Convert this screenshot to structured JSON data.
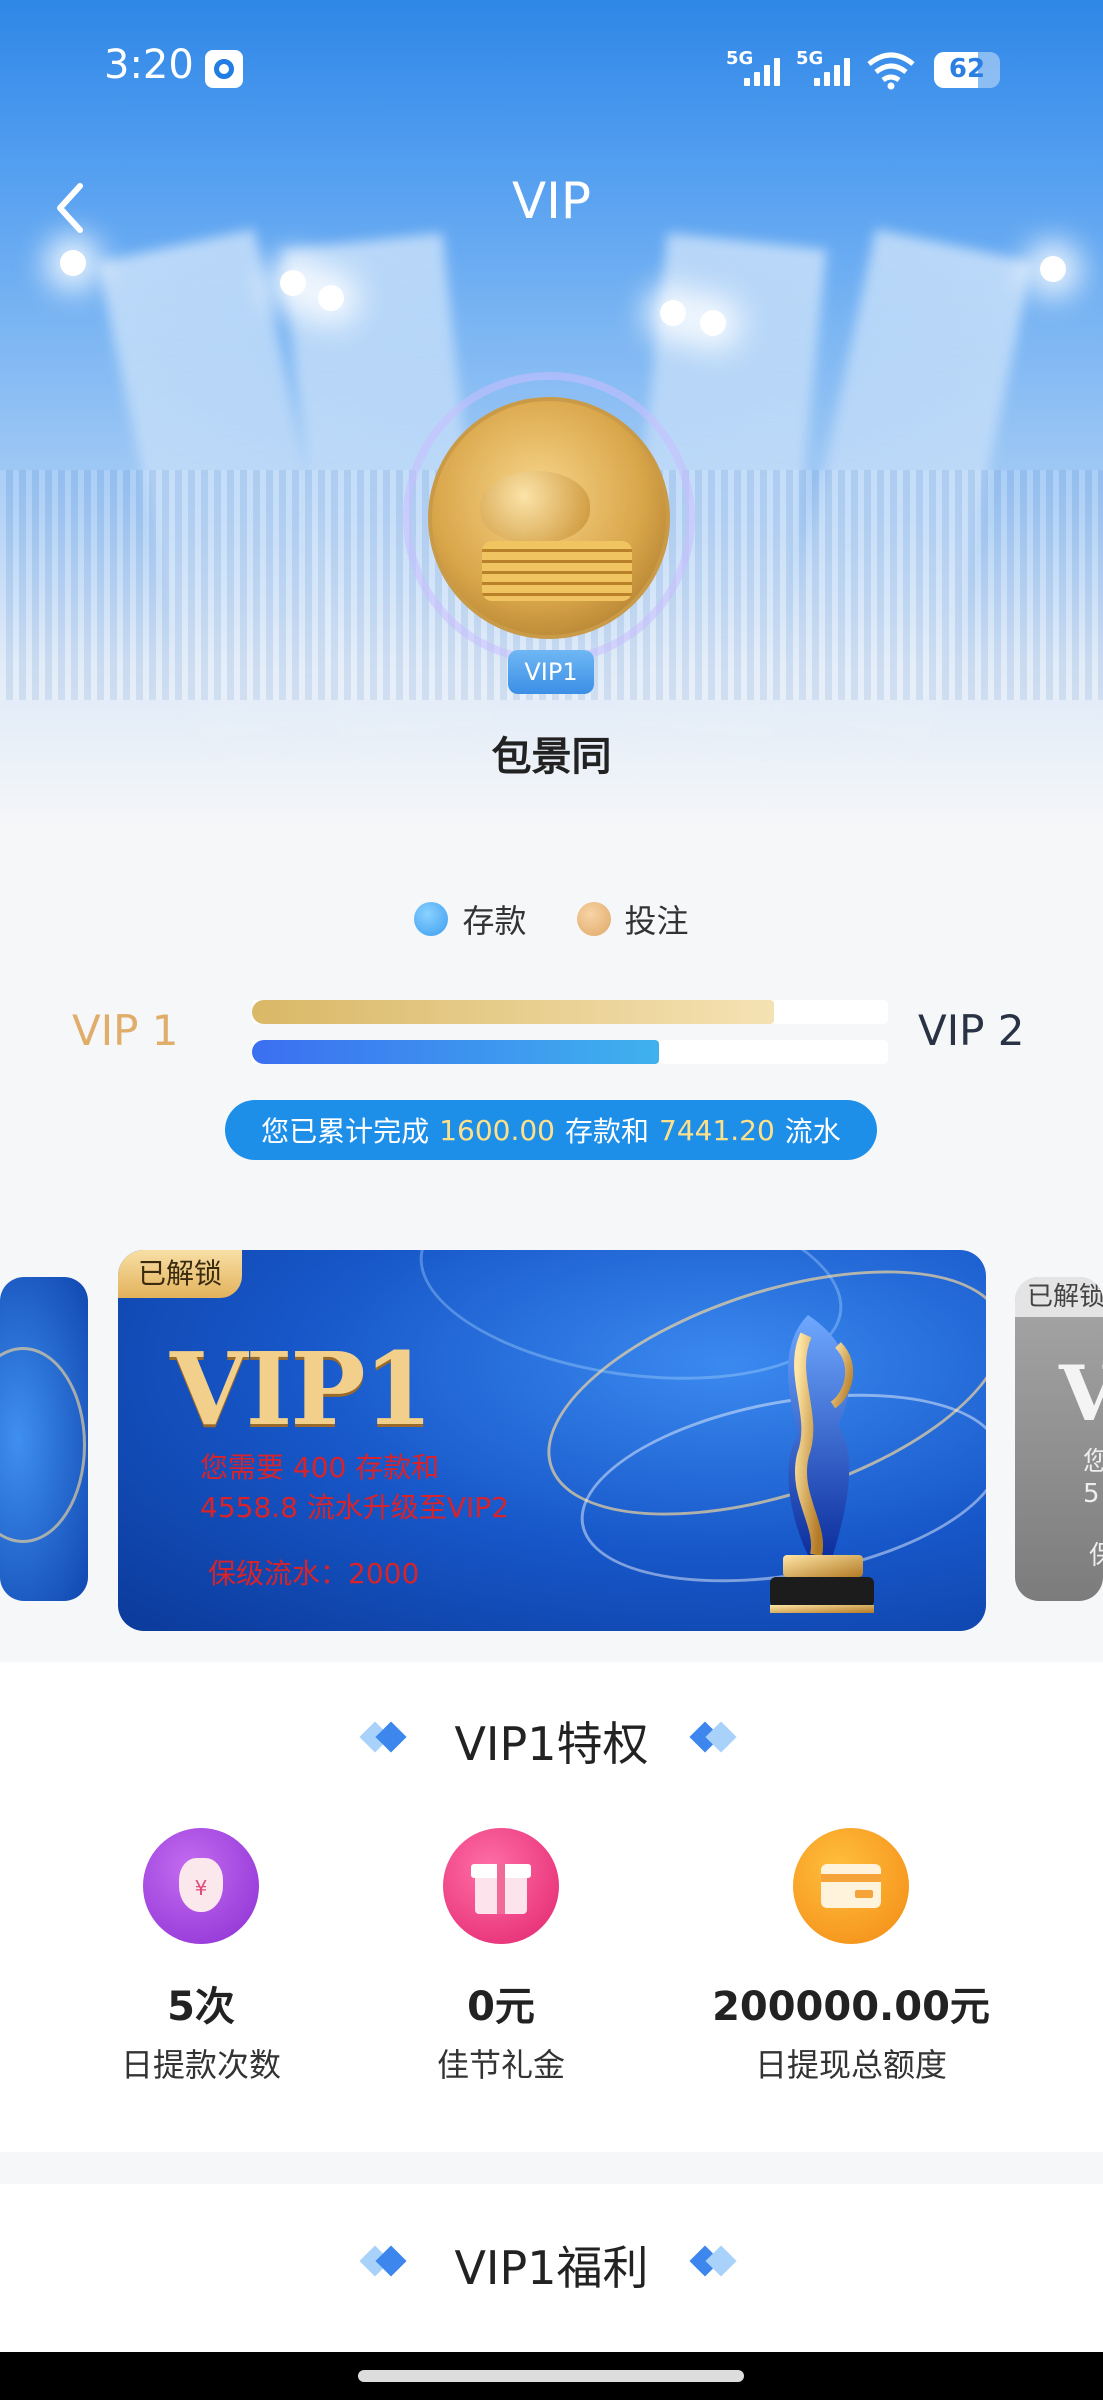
{
  "status_bar": {
    "time": "3:20",
    "signal_1": "5G",
    "signal_2": "5G",
    "battery": "62"
  },
  "header": {
    "title": "VIP"
  },
  "profile": {
    "badge": "VIP1",
    "name": "包景同"
  },
  "legend": {
    "deposit": "存款",
    "bet": "投注",
    "deposit_color": "#4fb0f2",
    "bet_color": "#e8b87a"
  },
  "progress": {
    "current_level": "VIP 1",
    "next_level": "VIP 2",
    "bet_progress": 0.82,
    "deposit_progress": 0.64,
    "summary_prefix": "您已累计完成",
    "deposit_amount": "1600.00",
    "summary_mid": "存款和",
    "turnover_amount": "7441.20",
    "summary_suffix": "流水"
  },
  "card": {
    "tag": "已解锁",
    "level": "VIP1",
    "line1": "您需要 400 存款和",
    "line2": "4558.8 流水升级至VIP2",
    "line3": "保级流水：2000",
    "next_tag": "已解锁",
    "next_letter": "V",
    "next_text1": "您",
    "next_text2": "5",
    "next_text3": "保"
  },
  "privileges": {
    "title": "VIP1特权",
    "items": [
      {
        "value": "5次",
        "label": "日提款次数",
        "icon": "money-bag-icon"
      },
      {
        "value": "0元",
        "label": "佳节礼金",
        "icon": "gift-icon"
      },
      {
        "value": "200000.00元",
        "label": "日提现总额度",
        "icon": "card-icon"
      }
    ]
  },
  "benefits": {
    "title": "VIP1福利"
  }
}
